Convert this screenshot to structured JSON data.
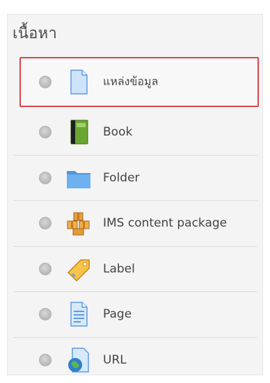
{
  "section": {
    "title": "เนื้อหา"
  },
  "items": [
    {
      "label": "แหล่งข้อมูล",
      "icon": "file-icon",
      "selected": true
    },
    {
      "label": "Book",
      "icon": "book-icon",
      "selected": false
    },
    {
      "label": "Folder",
      "icon": "folder-icon",
      "selected": false
    },
    {
      "label": "IMS content package",
      "icon": "ims-package-icon",
      "selected": false
    },
    {
      "label": "Label",
      "icon": "label-tag-icon",
      "selected": false
    },
    {
      "label": "Page",
      "icon": "page-icon",
      "selected": false
    },
    {
      "label": "URL",
      "icon": "url-globe-icon",
      "selected": false
    }
  ],
  "colors": {
    "selection_border": "#d9454a",
    "panel_bg": "#f4f4f4",
    "text": "#444444"
  }
}
